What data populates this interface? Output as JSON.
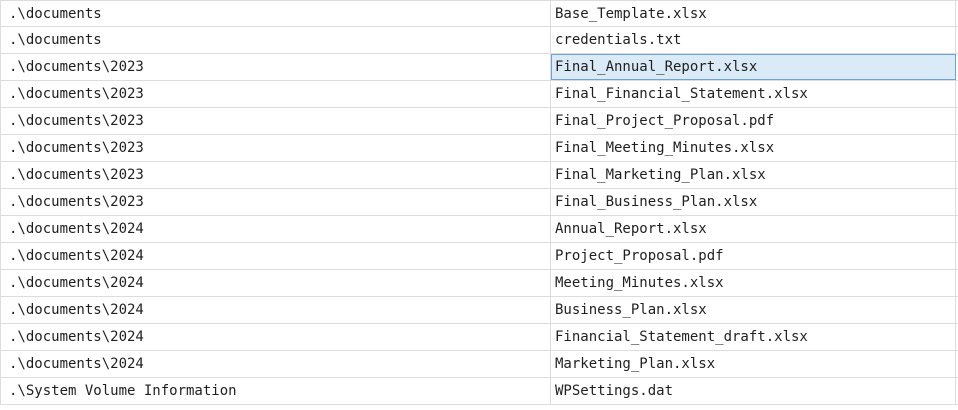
{
  "table": {
    "rows": [
      {
        "path": ".\\documents",
        "file": "Base_Template.xlsx"
      },
      {
        "path": ".\\documents",
        "file": "credentials.txt"
      },
      {
        "path": ".\\documents\\2023",
        "file": "Final_Annual_Report.xlsx",
        "selected": true
      },
      {
        "path": ".\\documents\\2023",
        "file": "Final_Financial_Statement.xlsx"
      },
      {
        "path": ".\\documents\\2023",
        "file": "Final_Project_Proposal.pdf"
      },
      {
        "path": ".\\documents\\2023",
        "file": "Final_Meeting_Minutes.xlsx"
      },
      {
        "path": ".\\documents\\2023",
        "file": "Final_Marketing_Plan.xlsx"
      },
      {
        "path": ".\\documents\\2023",
        "file": "Final_Business_Plan.xlsx"
      },
      {
        "path": ".\\documents\\2024",
        "file": "Annual_Report.xlsx"
      },
      {
        "path": ".\\documents\\2024",
        "file": "Project_Proposal.pdf"
      },
      {
        "path": ".\\documents\\2024",
        "file": "Meeting_Minutes.xlsx"
      },
      {
        "path": ".\\documents\\2024",
        "file": "Business_Plan.xlsx"
      },
      {
        "path": ".\\documents\\2024",
        "file": "Financial_Statement_draft.xlsx"
      },
      {
        "path": ".\\documents\\2024",
        "file": "Marketing_Plan.xlsx"
      },
      {
        "path": ".\\System Volume Information",
        "file": "WPSettings.dat"
      }
    ]
  },
  "colors": {
    "grid_line": "#dcdcdc",
    "selection_fill": "#dbeaf7",
    "selection_border": "#6fa3d8",
    "text": "#1f1f1f"
  }
}
